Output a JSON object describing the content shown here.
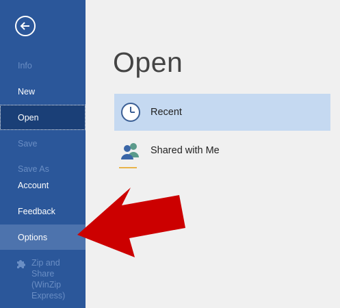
{
  "sidebar": {
    "back_icon": "back-arrow-icon",
    "items": [
      {
        "label": "Info",
        "state": "disabled"
      },
      {
        "label": "New",
        "state": "normal"
      },
      {
        "label": "Open",
        "state": "selected"
      },
      {
        "label": "Save",
        "state": "disabled"
      },
      {
        "label": "Save As",
        "state": "disabled"
      },
      {
        "label": "Account",
        "state": "normal"
      },
      {
        "label": "Feedback",
        "state": "normal"
      },
      {
        "label": "Options",
        "state": "hover"
      }
    ],
    "addin": {
      "label": "Zip and\nShare\n(WinZip\nExpress)",
      "icon": "puzzle-piece-icon"
    }
  },
  "main": {
    "title": "Open",
    "locations": [
      {
        "label": "Recent",
        "icon": "clock-icon",
        "selected": true
      },
      {
        "label": "Shared with Me",
        "icon": "people-icon",
        "selected": false
      }
    ]
  },
  "colors": {
    "sidebar_bg": "#2b579a",
    "sidebar_selected": "#1a3f77",
    "sidebar_hover": "#4d73ad",
    "selected_location": "#c5d9f1",
    "annotation_arrow": "#cc0000"
  }
}
